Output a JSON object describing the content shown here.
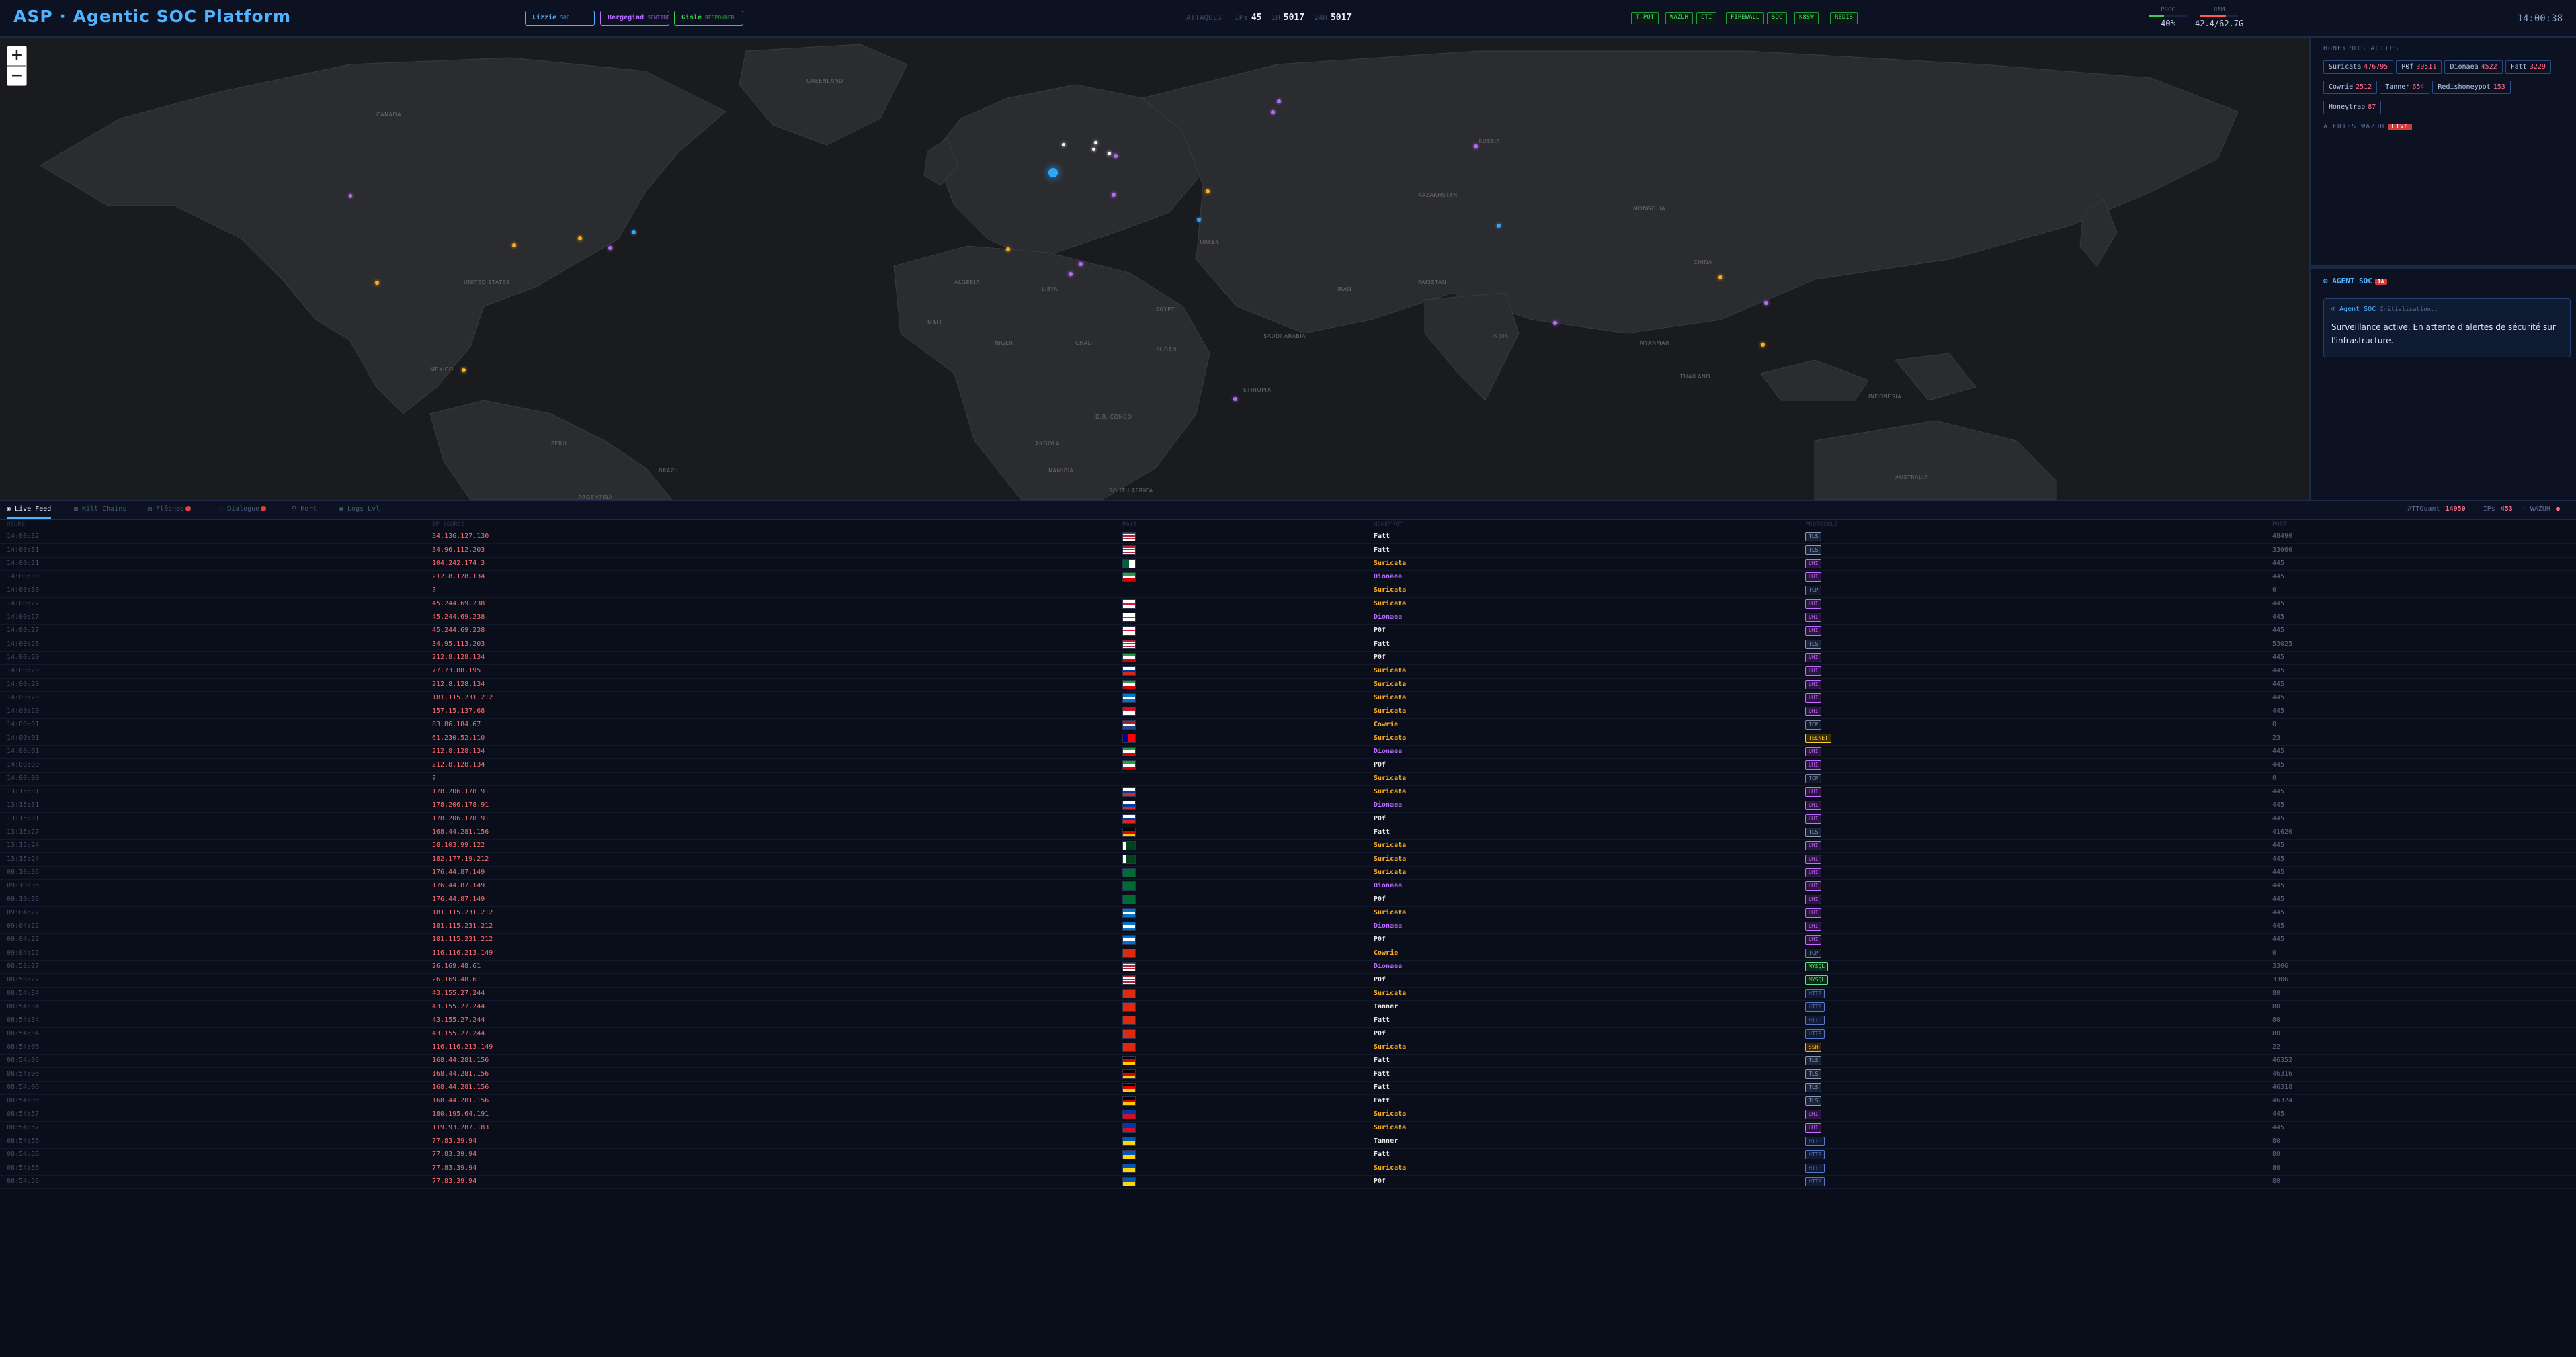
{
  "header": {
    "title": "ASP · Agentic SOC Platform",
    "users": [
      {
        "name": "Lizzie",
        "role": "SOC",
        "color": "#4fb3ff"
      },
      {
        "name": "Bergegind",
        "role": "SENTINEL",
        "color": "#b86bff"
      },
      {
        "name": "Gisle",
        "role": "RESPONDER",
        "color": "#3ccf4e"
      }
    ],
    "stats": [
      {
        "label": "ATTAQUES",
        "value": ""
      },
      {
        "label": "IPs",
        "value": "45"
      },
      {
        "label": "1H",
        "value": "5017"
      },
      {
        "label": "24H",
        "value": "5017"
      }
    ],
    "status_pills": [
      "T-POT",
      "WAZUH",
      "CTI",
      "FIREWALL",
      "SOC",
      "N8SW",
      "REDIS"
    ],
    "meters": [
      {
        "label": "PROC",
        "value": "40%",
        "fill": 0.4,
        "color": "#3ccf4e"
      },
      {
        "label": "RAM",
        "value": "42.4/62.7G",
        "fill": 0.68,
        "color": "#ff5a4a"
      }
    ],
    "clock": "14:00:38"
  },
  "map": {
    "zoom_in": "+",
    "zoom_out": "−",
    "country_labels": [
      "UNITED STATES",
      "MEXICO",
      "BRAZIL",
      "PERU",
      "ALGERIA",
      "LIBYA",
      "EGYPT",
      "NIGER",
      "CHAD",
      "SUDAN",
      "ETHIOPIA",
      "D.R. CONGO",
      "SOUTH AFRICA",
      "NAMIBIA",
      "KAZAKHSTAN",
      "MONGOLIA",
      "CHINA",
      "INDIA",
      "IRAN",
      "SAUDI ARABIA",
      "RUSSIA",
      "AUSTRALIA",
      "ARGENTINA",
      "ANGOLA",
      "MALI",
      "TURKEY",
      "PAKISTAN",
      "MYANMAR",
      "THAILAND",
      "INDONESIA",
      "GREENLAND",
      "CANADA"
    ]
  },
  "honeypots": {
    "title": "HONEYPOTS ACTIFS",
    "items": [
      {
        "name": "Suricata",
        "count": "476795"
      },
      {
        "name": "P0f",
        "count": "39511"
      },
      {
        "name": "Dionaea",
        "count": "4522"
      },
      {
        "name": "Fatt",
        "count": "3229"
      },
      {
        "name": "Cowrie",
        "count": "2512"
      },
      {
        "name": "Tanner",
        "count": "654"
      },
      {
        "name": "Redishoneypot",
        "count": "153"
      },
      {
        "name": "Honeytrap",
        "count": "87"
      }
    ]
  },
  "alerts": {
    "title": "ALERTES WAZUH",
    "badge": "LIVE"
  },
  "agent": {
    "title": "⊙ AGENT SOC",
    "badge": "IA",
    "name": "⊙ Agent SOC",
    "state": "Initialisation...",
    "message": "Surveillance active. En attente d'alertes de sécurité sur l'infrastructure."
  },
  "tabs": [
    {
      "label": "◉ Live Feed",
      "active": true,
      "dot": false
    },
    {
      "label": "▦ Kill Chains",
      "active": false,
      "dot": false
    },
    {
      "label": "▤ Flêches",
      "active": false,
      "dot": true
    },
    {
      "label": "◌ Dialogue",
      "active": false,
      "dot": true
    },
    {
      "label": "⚲ Hort",
      "active": false,
      "dot": false
    },
    {
      "label": "▣ Logs Lvl",
      "active": false,
      "dot": false
    }
  ],
  "tab_stats": [
    {
      "label": "ATTQuant",
      "value": "14950"
    },
    {
      "label": "·  IPs",
      "value": "453"
    },
    {
      "label": "·  WAZUH",
      "value": "●"
    }
  ],
  "table": {
    "headers": [
      "HEURE",
      "IP SOURCE",
      "PAYS",
      "HONEYPOT",
      "PROTOCOLE",
      "PORT"
    ],
    "rows": [
      {
        "time": "14:00:32",
        "ip": "34.136.127.130",
        "hp": "Fatt",
        "proto": "TLS",
        "port": "48490",
        "flag": "us"
      },
      {
        "time": "14:00:31",
        "ip": "34.96.112.203",
        "hp": "Fatt",
        "proto": "TLS",
        "port": "33060",
        "flag": "us"
      },
      {
        "time": "14:00:31",
        "ip": "104.242.174.3",
        "hp": "Suricata",
        "proto": "UHI",
        "port": "445",
        "flag": "dz"
      },
      {
        "time": "14:00:30",
        "ip": "212.8.128.134",
        "hp": "Dionaea",
        "proto": "UHI",
        "port": "445",
        "flag": "ir"
      },
      {
        "time": "14:00:30",
        "ip": "?",
        "hp": "Suricata",
        "proto": "TCP",
        "port": "0",
        "flag": ""
      },
      {
        "time": "14:00:27",
        "ip": "45.244.69.238",
        "hp": "Suricata",
        "proto": "UHI",
        "port": "445",
        "flag": "ge"
      },
      {
        "time": "14:00:27",
        "ip": "45.244.69.238",
        "hp": "Dionaea",
        "proto": "UHI",
        "port": "445",
        "flag": "ge"
      },
      {
        "time": "14:00:27",
        "ip": "45.244.69.238",
        "hp": "P0f",
        "proto": "UHI",
        "port": "445",
        "flag": "ge"
      },
      {
        "time": "14:00:26",
        "ip": "34.95.113.203",
        "hp": "Fatt",
        "proto": "TLS",
        "port": "53025",
        "flag": "us"
      },
      {
        "time": "14:00:20",
        "ip": "212.8.128.134",
        "hp": "P0f",
        "proto": "UHI",
        "port": "445",
        "flag": "ir"
      },
      {
        "time": "14:00:20",
        "ip": "77.73.88.195",
        "hp": "Suricata",
        "proto": "UHI",
        "port": "445",
        "flag": "ru"
      },
      {
        "time": "14:00:20",
        "ip": "212.8.128.134",
        "hp": "Suricata",
        "proto": "UHI",
        "port": "445",
        "flag": "ir"
      },
      {
        "time": "14:00:20",
        "ip": "181.115.231.212",
        "hp": "Suricata",
        "proto": "UHI",
        "port": "445",
        "flag": "hn"
      },
      {
        "time": "14:00:20",
        "ip": "157.15.137.68",
        "hp": "Suricata",
        "proto": "UHI",
        "port": "445",
        "flag": "id"
      },
      {
        "time": "14:00:01",
        "ip": "83.86.184.67",
        "hp": "Cowrie",
        "proto": "TCP",
        "port": "0",
        "flag": "nl"
      },
      {
        "time": "14:00:01",
        "ip": "61.230.52.110",
        "hp": "Suricata",
        "proto": "TELNET",
        "port": "23",
        "flag": "tw"
      },
      {
        "time": "14:00:01",
        "ip": "212.8.128.134",
        "hp": "Dionaea",
        "proto": "UHI",
        "port": "445",
        "flag": "ir"
      },
      {
        "time": "14:00:00",
        "ip": "212.8.128.134",
        "hp": "P0f",
        "proto": "UHI",
        "port": "445",
        "flag": "ir"
      },
      {
        "time": "14:00:00",
        "ip": "?",
        "hp": "Suricata",
        "proto": "TCP",
        "port": "0",
        "flag": ""
      },
      {
        "time": "13:15:31",
        "ip": "178.206.178.91",
        "hp": "Suricata",
        "proto": "UHI",
        "port": "445",
        "flag": "ru"
      },
      {
        "time": "13:15:31",
        "ip": "178.206.178.91",
        "hp": "Dionaea",
        "proto": "UHI",
        "port": "445",
        "flag": "ru"
      },
      {
        "time": "13:15:31",
        "ip": "178.206.178.91",
        "hp": "P0f",
        "proto": "UHI",
        "port": "445",
        "flag": "ru"
      },
      {
        "time": "13:15:27",
        "ip": "168.44.281.156",
        "hp": "Fatt",
        "proto": "TLS",
        "port": "41620",
        "flag": "de"
      },
      {
        "time": "13:15:24",
        "ip": "58.103.99.122",
        "hp": "Suricata",
        "proto": "UHI",
        "port": "445",
        "flag": "pk"
      },
      {
        "time": "13:15:24",
        "ip": "182.177.19.212",
        "hp": "Suricata",
        "proto": "UHI",
        "port": "445",
        "flag": "pk"
      },
      {
        "time": "09:10:36",
        "ip": "176.44.87.149",
        "hp": "Suricata",
        "proto": "UHI",
        "port": "445",
        "flag": "sa"
      },
      {
        "time": "09:10:36",
        "ip": "176.44.87.149",
        "hp": "Dionaea",
        "proto": "UHI",
        "port": "445",
        "flag": "sa"
      },
      {
        "time": "09:10:36",
        "ip": "176.44.87.149",
        "hp": "P0f",
        "proto": "UHI",
        "port": "445",
        "flag": "sa"
      },
      {
        "time": "09:04:22",
        "ip": "181.115.231.212",
        "hp": "Suricata",
        "proto": "UHI",
        "port": "445",
        "flag": "hn"
      },
      {
        "time": "09:04:22",
        "ip": "181.115.231.212",
        "hp": "Dionaea",
        "proto": "UHI",
        "port": "445",
        "flag": "hn"
      },
      {
        "time": "09:04:22",
        "ip": "181.115.231.212",
        "hp": "P0f",
        "proto": "UHI",
        "port": "445",
        "flag": "hn"
      },
      {
        "time": "09:04:22",
        "ip": "116.116.213.149",
        "hp": "Cowrie",
        "proto": "TCP",
        "port": "0",
        "flag": "cn"
      },
      {
        "time": "08:58:27",
        "ip": "26.169.48.61",
        "hp": "Dionaea",
        "proto": "MYSQL",
        "port": "3306",
        "flag": "us"
      },
      {
        "time": "08:58:27",
        "ip": "26.169.48.61",
        "hp": "P0f",
        "proto": "MYSQL",
        "port": "3306",
        "flag": "us"
      },
      {
        "time": "08:54:34",
        "ip": "43.155.27.244",
        "hp": "Suricata",
        "proto": "HTTP",
        "port": "80",
        "flag": "hk"
      },
      {
        "time": "08:54:34",
        "ip": "43.155.27.244",
        "hp": "Tanner",
        "proto": "HTTP",
        "port": "80",
        "flag": "hk"
      },
      {
        "time": "08:54:34",
        "ip": "43.155.27.244",
        "hp": "Fatt",
        "proto": "HTTP",
        "port": "80",
        "flag": "hk"
      },
      {
        "time": "08:54:34",
        "ip": "43.155.27.244",
        "hp": "P0f",
        "proto": "HTTP",
        "port": "80",
        "flag": "hk"
      },
      {
        "time": "08:54:06",
        "ip": "116.116.213.149",
        "hp": "Suricata",
        "proto": "SSH",
        "port": "22",
        "flag": "cn"
      },
      {
        "time": "08:54:06",
        "ip": "168.44.281.156",
        "hp": "Fatt",
        "proto": "TLS",
        "port": "46352",
        "flag": "de"
      },
      {
        "time": "08:54:06",
        "ip": "168.44.281.156",
        "hp": "Fatt",
        "proto": "TLS",
        "port": "46316",
        "flag": "de"
      },
      {
        "time": "08:54:06",
        "ip": "168.44.281.156",
        "hp": "Fatt",
        "proto": "TLS",
        "port": "46318",
        "flag": "de"
      },
      {
        "time": "08:54:05",
        "ip": "168.44.281.156",
        "hp": "Fatt",
        "proto": "TLS",
        "port": "46324",
        "flag": "de"
      },
      {
        "time": "08:54:57",
        "ip": "180.195.64.191",
        "hp": "Suricata",
        "proto": "UHI",
        "port": "445",
        "flag": "ph"
      },
      {
        "time": "08:54:57",
        "ip": "119.93.287.183",
        "hp": "Suricata",
        "proto": "UHI",
        "port": "445",
        "flag": "ph"
      },
      {
        "time": "08:54:56",
        "ip": "77.83.39.94",
        "hp": "Tanner",
        "proto": "HTTP",
        "port": "80",
        "flag": "ua"
      },
      {
        "time": "08:54:56",
        "ip": "77.83.39.94",
        "hp": "Fatt",
        "proto": "HTTP",
        "port": "80",
        "flag": "ua"
      },
      {
        "time": "08:54:56",
        "ip": "77.83.39.94",
        "hp": "Suricata",
        "proto": "HTTP",
        "port": "80",
        "flag": "ua"
      },
      {
        "time": "08:54:56",
        "ip": "77.83.39.94",
        "hp": "P0f",
        "proto": "HTTP",
        "port": "80",
        "flag": "ua"
      }
    ]
  },
  "colors": {
    "hp": {
      "Fatt": "#e6e6e6",
      "Suricata": "#ffb020",
      "Dionaea": "#b86bff",
      "P0f": "#e6e6e6",
      "Cowrie": "#ffb020",
      "Tanner": "#e6e6e6"
    },
    "proto": {
      "TLS": [
        "#8a9bb8",
        "#1b2438"
      ],
      "UHI": [
        "#c86bff",
        "#2a1640"
      ],
      "TCP": [
        "#7a8aa8",
        "#121a2c"
      ],
      "TELNET": [
        "#ffcc33",
        "#3a2e08"
      ],
      "MYSQL": [
        "#66e08a",
        "#0e2a18"
      ],
      "HTTP": [
        "#5a7ac8",
        "#101a34"
      ],
      "SSH": [
        "#ffb020",
        "#3a2808"
      ]
    }
  }
}
